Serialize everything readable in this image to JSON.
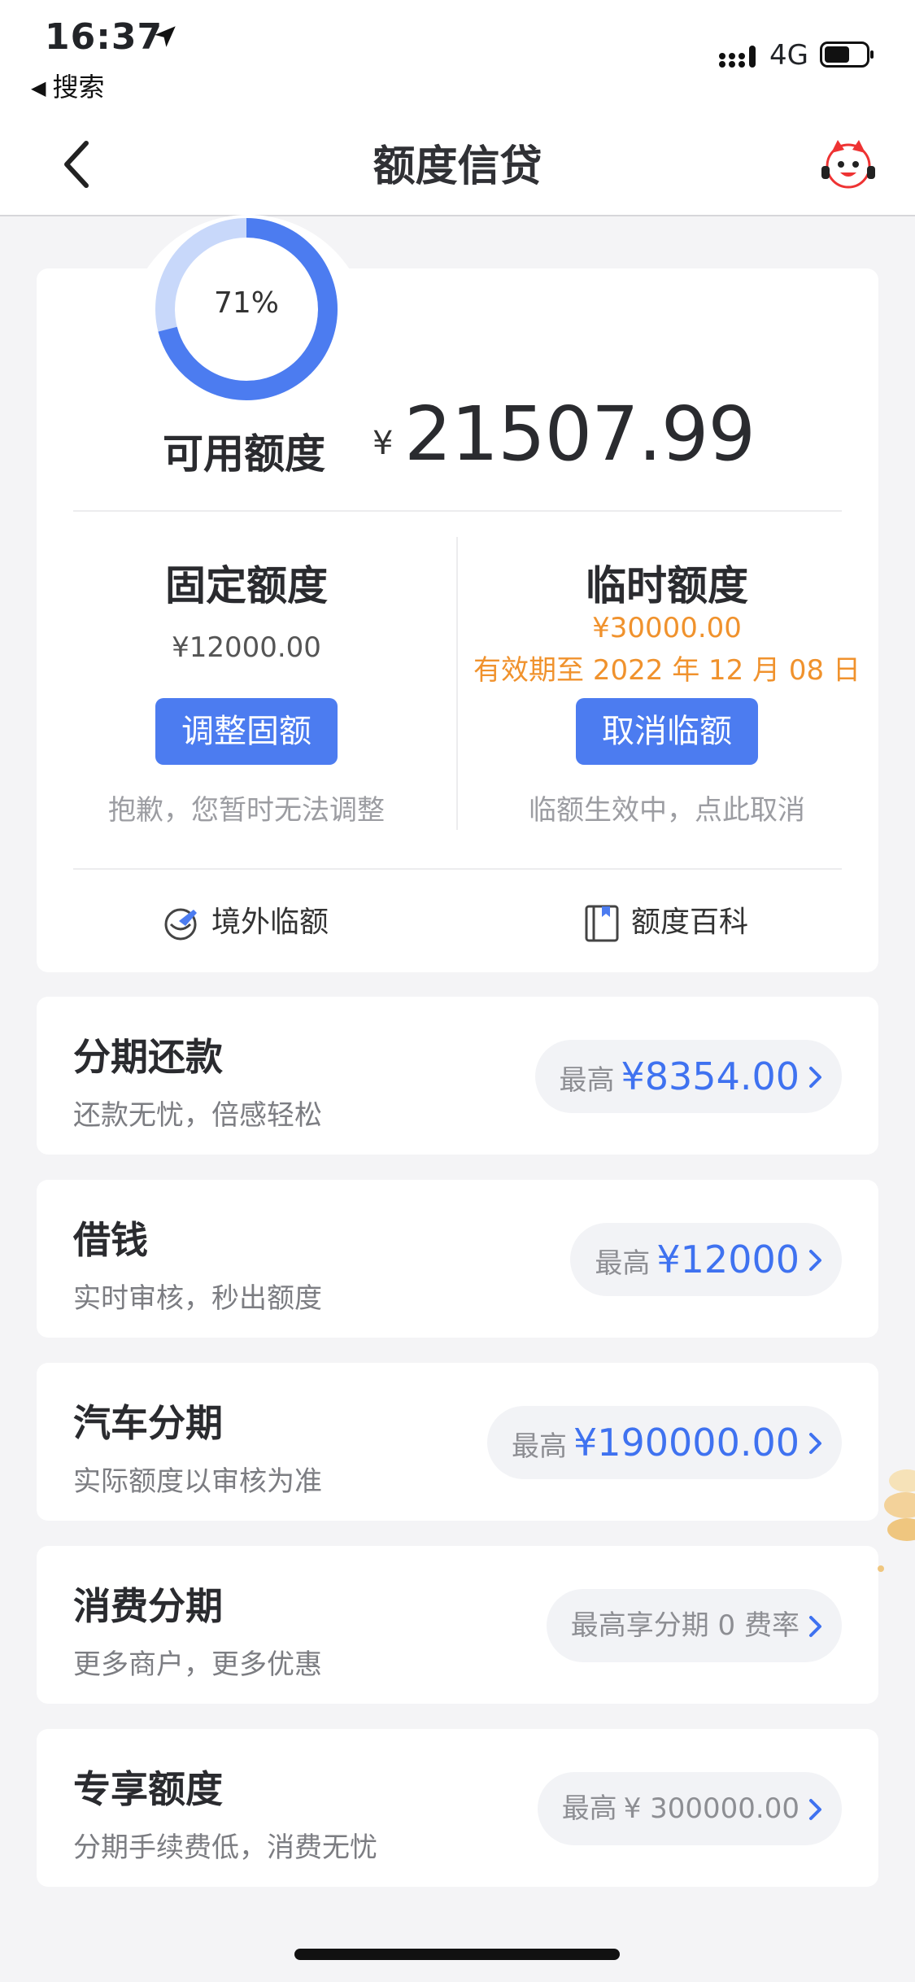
{
  "status_bar": {
    "time": "16:37",
    "back_app": "搜索",
    "network": "4G"
  },
  "nav": {
    "title": "额度信贷"
  },
  "credit": {
    "percent": "71%",
    "percent_value": 71,
    "available_label": "可用额度",
    "currency": "¥",
    "available_amount": "21507.99",
    "fixed": {
      "title": "固定额度",
      "amount": "¥12000.00",
      "button": "调整固额",
      "note": "抱歉，您暂时无法调整"
    },
    "temporary": {
      "title": "临时额度",
      "amount": "¥30000.00",
      "validity": "有效期至 2022 年 12 月 08 日",
      "button": "取消临额",
      "note": "临额生效中，点此取消"
    },
    "links": {
      "overseas": "境外临额",
      "wiki": "额度百科"
    }
  },
  "products": [
    {
      "title": "分期还款",
      "subtitle": "还款无忧，倍感轻松",
      "prefix": "最高",
      "amount": "¥8354.00"
    },
    {
      "title": "借钱",
      "subtitle": "实时审核，秒出额度",
      "prefix": "最高",
      "amount": "¥12000"
    },
    {
      "title": "汽车分期",
      "subtitle": "实际额度以审核为准",
      "prefix": "最高",
      "amount": "¥190000.00"
    },
    {
      "title": "消费分期",
      "subtitle": "更多商户，更多优惠",
      "prefix": "最高享分期 0 费率",
      "amount": ""
    },
    {
      "title": "专享额度",
      "subtitle": "分期手续费低，消费无忧",
      "prefix": "最高",
      "amount": "¥ 300000.00"
    }
  ],
  "colors": {
    "accent": "#4c7cf0",
    "amount_blue": "#3f72f0",
    "orange": "#f0922d",
    "ring_light": "#c8d8fa"
  },
  "icons": {
    "location": "location-arrow-icon",
    "signal": "signal-icon",
    "battery": "battery-icon",
    "back": "chevron-left-icon",
    "avatar": "mascot-avatar-icon",
    "overseas": "plane-globe-icon",
    "wiki": "book-icon",
    "chevron": "chevron-right-icon"
  }
}
